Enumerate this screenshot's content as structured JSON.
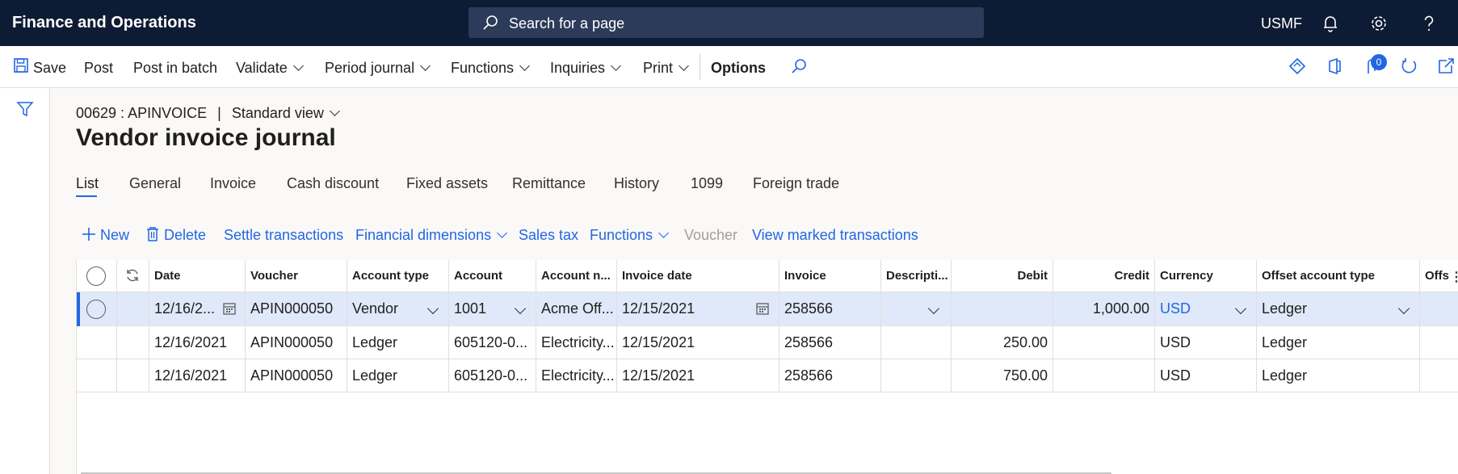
{
  "topbar": {
    "app_title": "Finance and Operations",
    "search_placeholder": "Search for a page",
    "company": "USMF"
  },
  "actionpane": {
    "save": "Save",
    "post": "Post",
    "post_in_batch": "Post in batch",
    "validate": "Validate",
    "period_journal": "Period journal",
    "functions": "Functions",
    "inquiries": "Inquiries",
    "print": "Print",
    "options": "Options",
    "badge_count": "0"
  },
  "header": {
    "journal_id": "00629 : APINVOICE",
    "separator": "|",
    "view_name": "Standard view",
    "title": "Vendor invoice journal"
  },
  "tabs": [
    "List",
    "General",
    "Invoice",
    "Cash discount",
    "Fixed assets",
    "Remittance",
    "History",
    "1099",
    "Foreign trade"
  ],
  "grid_toolbar": {
    "new": "New",
    "delete": "Delete",
    "settle_transactions": "Settle transactions",
    "financial_dimensions": "Financial dimensions",
    "sales_tax": "Sales tax",
    "functions": "Functions",
    "voucher": "Voucher",
    "view_marked_transactions": "View marked transactions"
  },
  "grid": {
    "columns": [
      "Date",
      "Voucher",
      "Account type",
      "Account",
      "Account n...",
      "Invoice date",
      "Invoice",
      "Descripti...",
      "Debit",
      "Credit",
      "Currency",
      "Offset account type",
      "Offs"
    ],
    "rows": [
      {
        "date": "12/16/2...",
        "voucher": "APIN000050",
        "account_type": "Vendor",
        "account": "1001",
        "account_name": "Acme Off...",
        "invoice_date": "12/15/2021",
        "invoice": "258566",
        "description": "",
        "debit": "",
        "credit": "1,000.00",
        "currency": "USD",
        "offset_account_type": "Ledger"
      },
      {
        "date": "12/16/2021",
        "voucher": "APIN000050",
        "account_type": "Ledger",
        "account": "605120-0...",
        "account_name": "Electricity...",
        "invoice_date": "12/15/2021",
        "invoice": "258566",
        "description": "",
        "debit": "250.00",
        "credit": "",
        "currency": "USD",
        "offset_account_type": "Ledger"
      },
      {
        "date": "12/16/2021",
        "voucher": "APIN000050",
        "account_type": "Ledger",
        "account": "605120-0...",
        "account_name": "Electricity...",
        "invoice_date": "12/15/2021",
        "invoice": "258566",
        "description": "",
        "debit": "750.00",
        "credit": "",
        "currency": "USD",
        "offset_account_type": "Ledger"
      }
    ]
  },
  "colors": {
    "topbar": "#0e1b34",
    "accent": "#2266e3",
    "selected_row": "#dfe9f9"
  },
  "icons": [
    "search-icon",
    "bell-icon",
    "gear-icon",
    "help-icon",
    "save-icon",
    "filter-icon",
    "refresh-icon",
    "calendar-icon",
    "trash-icon",
    "plus-icon"
  ]
}
